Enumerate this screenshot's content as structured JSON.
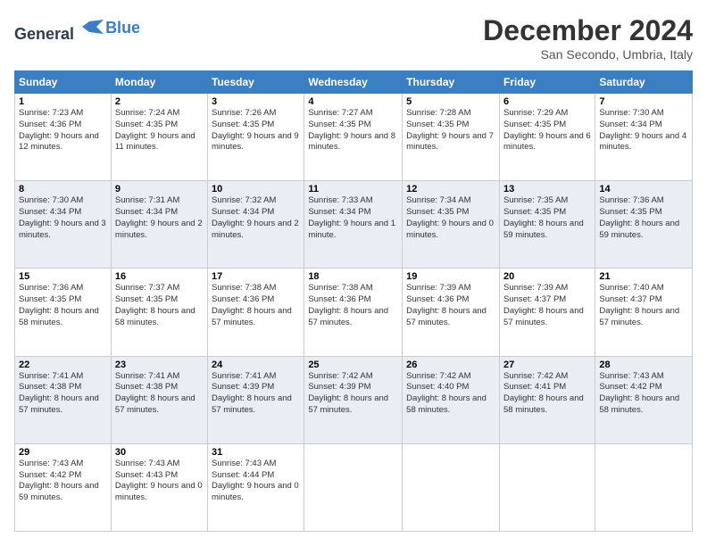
{
  "logo": {
    "line1": "General",
    "line2": "Blue"
  },
  "header": {
    "title": "December 2024",
    "location": "San Secondo, Umbria, Italy"
  },
  "days_of_week": [
    "Sunday",
    "Monday",
    "Tuesday",
    "Wednesday",
    "Thursday",
    "Friday",
    "Saturday"
  ],
  "weeks": [
    [
      {
        "day": "1",
        "sunrise": "7:23 AM",
        "sunset": "4:36 PM",
        "daylight": "9 hours and 12 minutes."
      },
      {
        "day": "2",
        "sunrise": "7:24 AM",
        "sunset": "4:35 PM",
        "daylight": "9 hours and 11 minutes."
      },
      {
        "day": "3",
        "sunrise": "7:26 AM",
        "sunset": "4:35 PM",
        "daylight": "9 hours and 9 minutes."
      },
      {
        "day": "4",
        "sunrise": "7:27 AM",
        "sunset": "4:35 PM",
        "daylight": "9 hours and 8 minutes."
      },
      {
        "day": "5",
        "sunrise": "7:28 AM",
        "sunset": "4:35 PM",
        "daylight": "9 hours and 7 minutes."
      },
      {
        "day": "6",
        "sunrise": "7:29 AM",
        "sunset": "4:35 PM",
        "daylight": "9 hours and 6 minutes."
      },
      {
        "day": "7",
        "sunrise": "7:30 AM",
        "sunset": "4:34 PM",
        "daylight": "9 hours and 4 minutes."
      }
    ],
    [
      {
        "day": "8",
        "sunrise": "7:30 AM",
        "sunset": "4:34 PM",
        "daylight": "9 hours and 3 minutes."
      },
      {
        "day": "9",
        "sunrise": "7:31 AM",
        "sunset": "4:34 PM",
        "daylight": "9 hours and 2 minutes."
      },
      {
        "day": "10",
        "sunrise": "7:32 AM",
        "sunset": "4:34 PM",
        "daylight": "9 hours and 2 minutes."
      },
      {
        "day": "11",
        "sunrise": "7:33 AM",
        "sunset": "4:34 PM",
        "daylight": "9 hours and 1 minute."
      },
      {
        "day": "12",
        "sunrise": "7:34 AM",
        "sunset": "4:35 PM",
        "daylight": "9 hours and 0 minutes."
      },
      {
        "day": "13",
        "sunrise": "7:35 AM",
        "sunset": "4:35 PM",
        "daylight": "8 hours and 59 minutes."
      },
      {
        "day": "14",
        "sunrise": "7:36 AM",
        "sunset": "4:35 PM",
        "daylight": "8 hours and 59 minutes."
      }
    ],
    [
      {
        "day": "15",
        "sunrise": "7:36 AM",
        "sunset": "4:35 PM",
        "daylight": "8 hours and 58 minutes."
      },
      {
        "day": "16",
        "sunrise": "7:37 AM",
        "sunset": "4:35 PM",
        "daylight": "8 hours and 58 minutes."
      },
      {
        "day": "17",
        "sunrise": "7:38 AM",
        "sunset": "4:36 PM",
        "daylight": "8 hours and 57 minutes."
      },
      {
        "day": "18",
        "sunrise": "7:38 AM",
        "sunset": "4:36 PM",
        "daylight": "8 hours and 57 minutes."
      },
      {
        "day": "19",
        "sunrise": "7:39 AM",
        "sunset": "4:36 PM",
        "daylight": "8 hours and 57 minutes."
      },
      {
        "day": "20",
        "sunrise": "7:39 AM",
        "sunset": "4:37 PM",
        "daylight": "8 hours and 57 minutes."
      },
      {
        "day": "21",
        "sunrise": "7:40 AM",
        "sunset": "4:37 PM",
        "daylight": "8 hours and 57 minutes."
      }
    ],
    [
      {
        "day": "22",
        "sunrise": "7:41 AM",
        "sunset": "4:38 PM",
        "daylight": "8 hours and 57 minutes."
      },
      {
        "day": "23",
        "sunrise": "7:41 AM",
        "sunset": "4:38 PM",
        "daylight": "8 hours and 57 minutes."
      },
      {
        "day": "24",
        "sunrise": "7:41 AM",
        "sunset": "4:39 PM",
        "daylight": "8 hours and 57 minutes."
      },
      {
        "day": "25",
        "sunrise": "7:42 AM",
        "sunset": "4:39 PM",
        "daylight": "8 hours and 57 minutes."
      },
      {
        "day": "26",
        "sunrise": "7:42 AM",
        "sunset": "4:40 PM",
        "daylight": "8 hours and 58 minutes."
      },
      {
        "day": "27",
        "sunrise": "7:42 AM",
        "sunset": "4:41 PM",
        "daylight": "8 hours and 58 minutes."
      },
      {
        "day": "28",
        "sunrise": "7:43 AM",
        "sunset": "4:42 PM",
        "daylight": "8 hours and 58 minutes."
      }
    ],
    [
      {
        "day": "29",
        "sunrise": "7:43 AM",
        "sunset": "4:42 PM",
        "daylight": "8 hours and 59 minutes."
      },
      {
        "day": "30",
        "sunrise": "7:43 AM",
        "sunset": "4:43 PM",
        "daylight": "9 hours and 0 minutes."
      },
      {
        "day": "31",
        "sunrise": "7:43 AM",
        "sunset": "4:44 PM",
        "daylight": "9 hours and 0 minutes."
      },
      null,
      null,
      null,
      null
    ]
  ]
}
